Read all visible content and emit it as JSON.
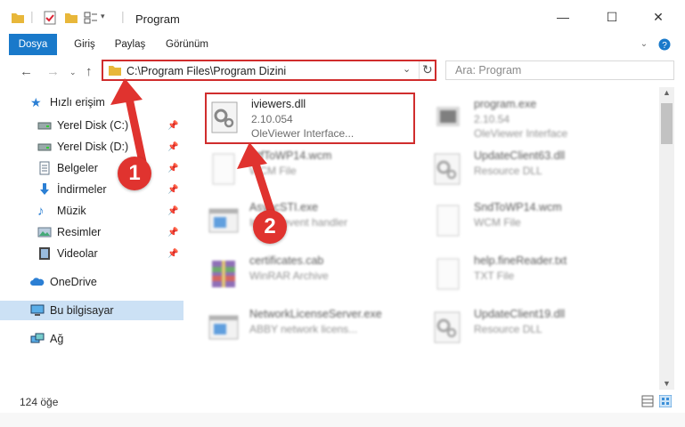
{
  "window": {
    "title": "Program"
  },
  "ribbon": {
    "tabs": [
      "Dosya",
      "Giriş",
      "Paylaş",
      "Görünüm"
    ]
  },
  "address": {
    "path": "C:\\Program Files\\Program Dizini"
  },
  "search": {
    "placeholder": "Ara: Program"
  },
  "nav": {
    "quick_access": "Hızlı erişim",
    "items": [
      {
        "label": "Yerel Disk (C:)",
        "icon": "drive-icon",
        "pinned": true
      },
      {
        "label": "Yerel Disk (D:)",
        "icon": "drive-icon",
        "pinned": true
      },
      {
        "label": "Belgeler",
        "icon": "documents-icon",
        "pinned": true
      },
      {
        "label": "İndirmeler",
        "icon": "download-icon",
        "pinned": true
      },
      {
        "label": "Müzik",
        "icon": "music-icon",
        "pinned": true
      },
      {
        "label": "Resimler",
        "icon": "pictures-icon",
        "pinned": true
      },
      {
        "label": "Videolar",
        "icon": "video-icon",
        "pinned": true
      }
    ],
    "onedrive": "OneDrive",
    "this_pc": "Bu bilgisayar",
    "network": "Ağ"
  },
  "files": [
    {
      "name": "iviewers.dll",
      "version": "2.10.054",
      "desc": "OleViewer Interface...",
      "icon": "gear-file-icon",
      "highlight": true
    },
    {
      "name": "program.exe",
      "version": "2.10.54",
      "desc": "OleViewer Interface",
      "icon": "exe-icon"
    },
    {
      "name": "RtfToWP14.wcm",
      "version": "WCM File",
      "desc": "",
      "icon": "blank-file-icon"
    },
    {
      "name": "UpdateClient63.dll",
      "version": "Resource DLL",
      "desc": "",
      "icon": "gear-file-icon"
    },
    {
      "name": "AsyncSTI.exe",
      "version": "Import event handler",
      "desc": "",
      "icon": "window-icon"
    },
    {
      "name": "SndToWP14.wcm",
      "version": "WCM File",
      "desc": "",
      "icon": "blank-file-icon"
    },
    {
      "name": "certificates.cab",
      "version": "WinRAR Archive",
      "desc": "",
      "icon": "archive-icon"
    },
    {
      "name": "help.fineReader.txt",
      "version": "TXT File",
      "desc": "",
      "icon": "blank-file-icon"
    },
    {
      "name": "NetworkLicenseServer.exe",
      "version": "ABBY network licens...",
      "desc": "",
      "icon": "window-icon"
    },
    {
      "name": "UpdateClient19.dll",
      "version": "Resource DLL",
      "desc": "",
      "icon": "gear-file-icon"
    }
  ],
  "status": {
    "count": "124 öğe"
  },
  "annotations": {
    "step1": "1",
    "step2": "2"
  },
  "colors": {
    "accent": "#1979ca",
    "highlight": "#d02d2d",
    "selected_nav": "#cce1f5"
  }
}
